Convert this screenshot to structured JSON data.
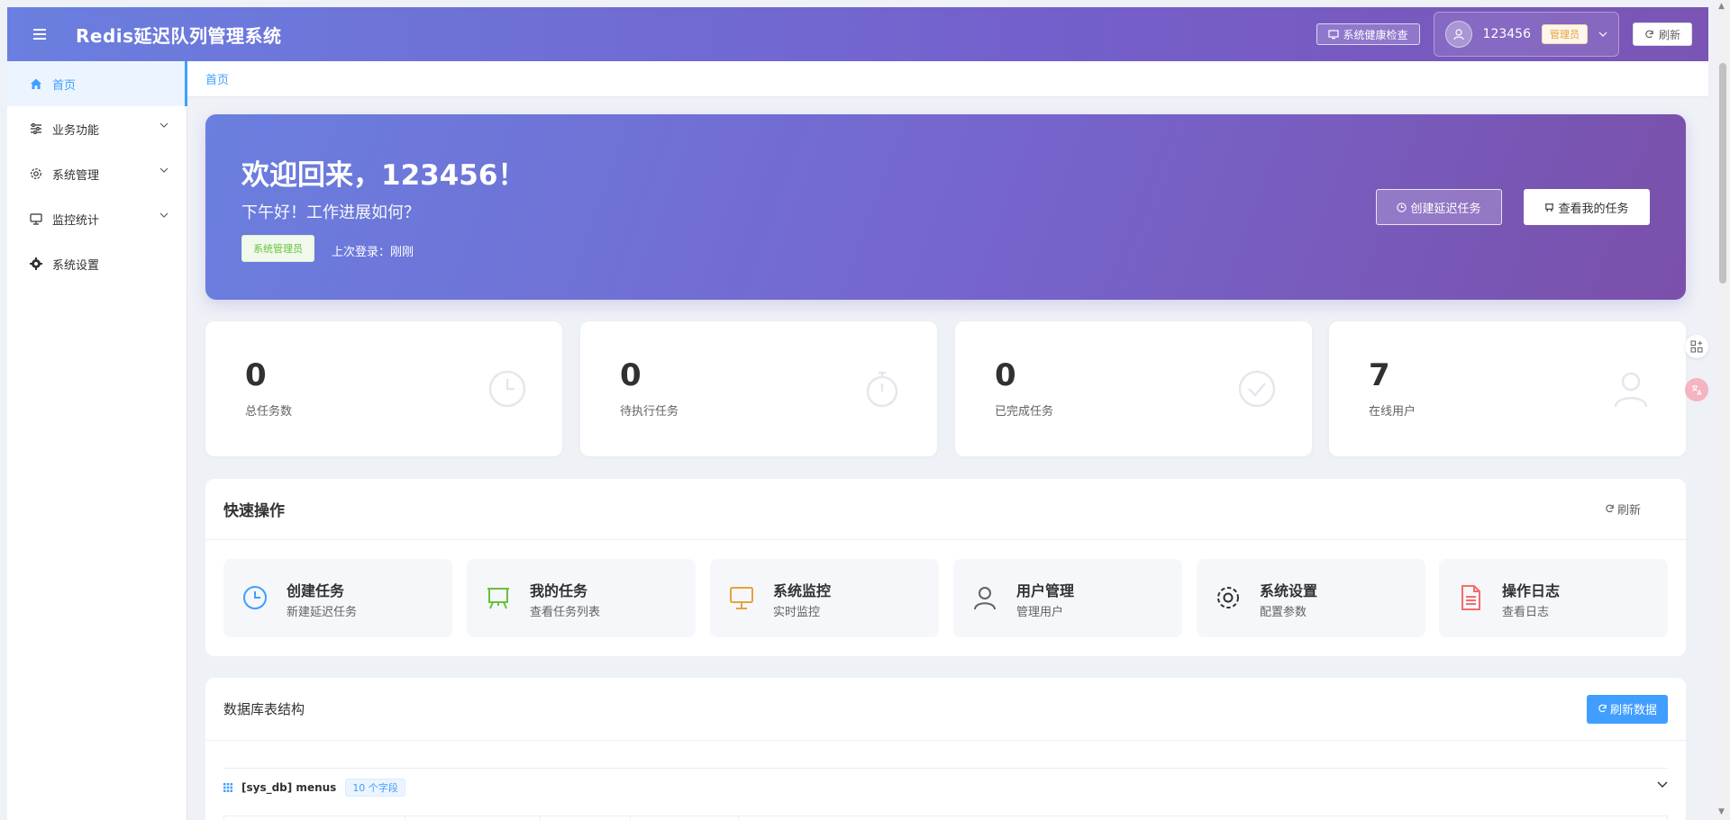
{
  "header": {
    "title": "Redis延迟队列管理系统",
    "health_check": "系统健康检查",
    "username": "123456",
    "role": "管理员",
    "refresh": "刷新"
  },
  "sidebar": {
    "items": [
      {
        "label": "首页",
        "icon": "home-icon",
        "active": true
      },
      {
        "label": "业务功能",
        "icon": "sliders-icon"
      },
      {
        "label": "系统管理",
        "icon": "gear-icon"
      },
      {
        "label": "监控统计",
        "icon": "monitor-icon"
      },
      {
        "label": "系统设置",
        "icon": "cog-icon"
      }
    ]
  },
  "breadcrumb": "首页",
  "welcome": {
    "title": "欢迎回来，123456！",
    "subtitle": "下午好！工作进展如何？",
    "role_tag": "系统管理员",
    "last_login": "上次登录：刚刚",
    "create_btn": "创建延迟任务",
    "view_btn": "查看我的任务"
  },
  "stats": [
    {
      "value": "0",
      "label": "总任务数",
      "icon": "clock-icon"
    },
    {
      "value": "0",
      "label": "待执行任务",
      "icon": "stopwatch-icon"
    },
    {
      "value": "0",
      "label": "已完成任务",
      "icon": "check-circle-icon"
    },
    {
      "value": "7",
      "label": "在线用户",
      "icon": "user-icon"
    }
  ],
  "quick": {
    "title": "快速操作",
    "refresh": "刷新",
    "items": [
      {
        "title": "创建任务",
        "sub": "新建延迟任务",
        "icon": "clock-icon",
        "color": "#409eff"
      },
      {
        "title": "我的任务",
        "sub": "查看任务列表",
        "icon": "board-icon",
        "color": "#67c23a"
      },
      {
        "title": "系统监控",
        "sub": "实时监控",
        "icon": "monitor-icon",
        "color": "#e6a23c"
      },
      {
        "title": "用户管理",
        "sub": "管理用户",
        "icon": "user-icon",
        "color": "#606266"
      },
      {
        "title": "系统设置",
        "sub": "配置参数",
        "icon": "gear-icon",
        "color": "#303133"
      },
      {
        "title": "操作日志",
        "sub": "查看日志",
        "icon": "document-icon",
        "color": "#f56c6c"
      }
    ]
  },
  "db": {
    "title": "数据库表结构",
    "refresh_btn": "刷新数据",
    "table_name": "[sys_db] menus",
    "field_count": "10 个字段"
  },
  "colors": {
    "primary": "#409eff",
    "header_start": "#6a7fdf",
    "header_end": "#7a55b4"
  }
}
